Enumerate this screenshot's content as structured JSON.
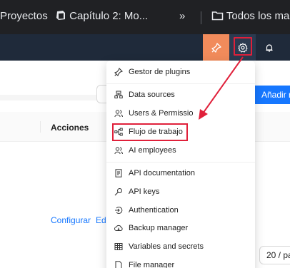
{
  "bookmarks": {
    "items": [
      {
        "label": "Proyectos",
        "icon": "none"
      },
      {
        "label": "Capítulo 2: Mo...",
        "icon": "notion-icon"
      },
      {
        "label": "»",
        "icon": "none"
      },
      {
        "label": "Todos los ma",
        "icon": "folder-icon"
      }
    ]
  },
  "header": {
    "plugin_icon": "pin-icon",
    "settings_icon": "gear-icon",
    "bell_icon": "bell-icon",
    "accent_color": "#f18b5b"
  },
  "page": {
    "add_button": "Añadir n",
    "table": {
      "actions_header": "Acciones",
      "row_links": [
        "Configurar",
        "Edi"
      ]
    },
    "pager": "20 / pa"
  },
  "menu": {
    "items": [
      {
        "label": "Gestor de plugins",
        "icon": "plugin-icon"
      },
      {
        "label": "Data sources",
        "icon": "database-icon"
      },
      {
        "label": "Users & Permissio",
        "icon": "users-icon"
      },
      {
        "label": "Flujo de trabajo",
        "icon": "workflow-icon"
      },
      {
        "label": "AI employees",
        "icon": "ai-employees-icon"
      },
      {
        "label": "API documentation",
        "icon": "document-icon"
      },
      {
        "label": "API keys",
        "icon": "key-icon"
      },
      {
        "label": "Authentication",
        "icon": "login-icon"
      },
      {
        "label": "Backup manager",
        "icon": "cloud-icon"
      },
      {
        "label": "Variables and secrets",
        "icon": "table-icon"
      },
      {
        "label": "File manager",
        "icon": "file-icon"
      }
    ]
  },
  "annotation": {
    "color": "#e0203a"
  }
}
